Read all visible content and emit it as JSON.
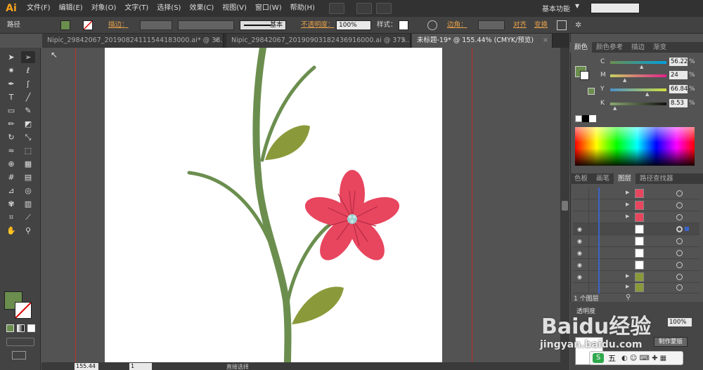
{
  "app": {
    "logo": "Ai",
    "workspace": "基本功能"
  },
  "menu": [
    "文件(F)",
    "编辑(E)",
    "对象(O)",
    "文字(T)",
    "选择(S)",
    "效果(C)",
    "视图(V)",
    "窗口(W)",
    "帮助(H)"
  ],
  "control": {
    "selection_type": "路径",
    "fill_color": "#6b8e4e",
    "stroke_label": "描边：",
    "stroke_style": "基本",
    "opacity_label": "不透明度：",
    "opacity_value": "100%",
    "style_label": "样式：",
    "corner_label": "边角：",
    "align_label": "对齐",
    "transform_label": "变换"
  },
  "tabs": [
    {
      "label": "Nipic_29842067_20190824111544183000.ai* @ 38...",
      "close": "×"
    },
    {
      "label": "Nipic_29842067_20190903182436916000.ai @ 375...",
      "close": "×"
    },
    {
      "label": "未标题-19* @ 155.44% (CMYK/预览)",
      "close": "×"
    }
  ],
  "status": {
    "zoom": "155.44",
    "page": "1",
    "mode": "直接选择"
  },
  "panels": {
    "color_tabs": [
      "颜色",
      "颜色参考",
      "描边",
      "渐变"
    ],
    "cmyk": [
      {
        "label": "C",
        "value": "56.22",
        "pct": "%"
      },
      {
        "label": "M",
        "value": "24",
        "pct": "%"
      },
      {
        "label": "Y",
        "value": "66.84",
        "pct": "%"
      },
      {
        "label": "K",
        "value": "8.53",
        "pct": "%"
      }
    ],
    "layer_tabs": [
      "色板",
      "画笔",
      "图层",
      "路径查找器"
    ],
    "layer_count": "1 个图层",
    "bottom_label": "透明度",
    "bottom_value": "100%",
    "make_mask": "制作蒙版"
  },
  "watermark": {
    "brand": "Baidu经验",
    "url": "jingyan.baidu.com"
  },
  "colors": {
    "stem": "#6b8e4e",
    "leaf": "#8a9a3a",
    "petal": "#e8455e",
    "center": "#9ecfcf",
    "accent": "#e8a14a"
  },
  "ime": {
    "label": "五"
  }
}
